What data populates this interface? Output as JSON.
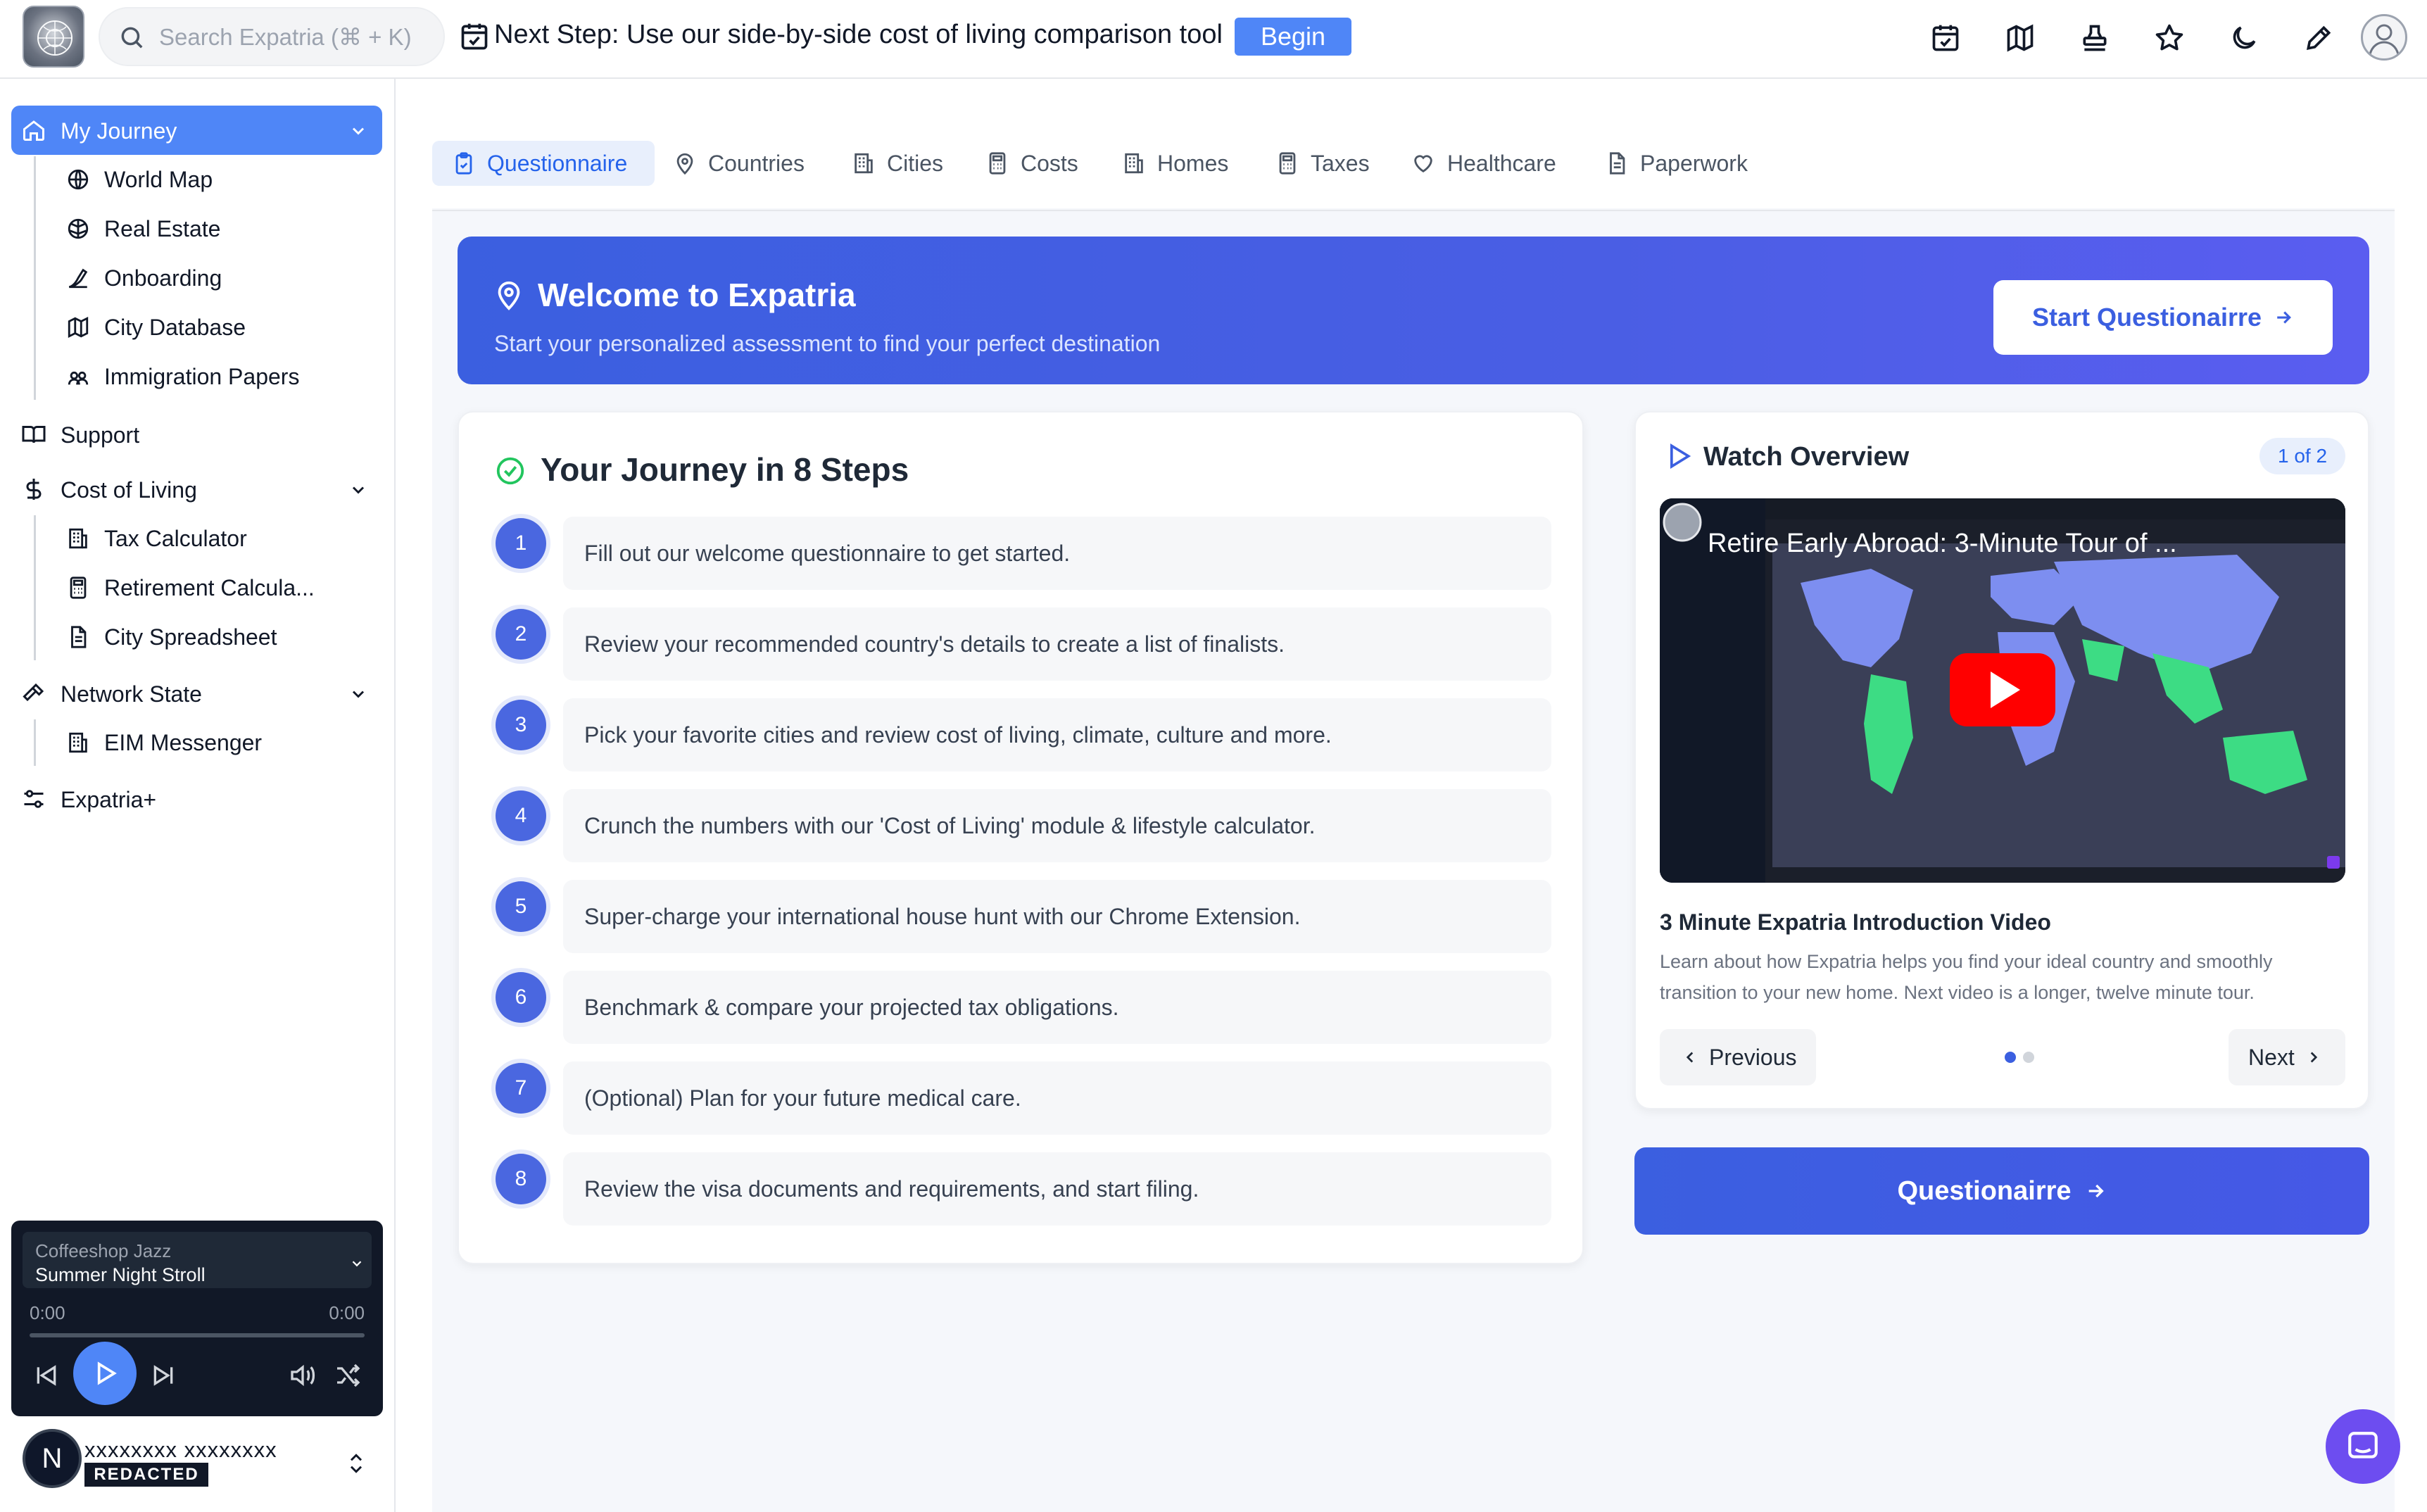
{
  "topbar": {
    "search_placeholder": "Search Expatria (⌘ + K)",
    "next_step_text": "Next Step: Use our side-by-side cost of living comparison tool",
    "begin_label": "Begin",
    "icons": [
      "calendar-check-icon",
      "map-icon",
      "stamp-icon",
      "star-icon",
      "moon-icon",
      "pencil-icon",
      "user-avatar-icon"
    ]
  },
  "sidebar": {
    "my_journey": "My Journey",
    "journey_items": [
      "World Map",
      "Real Estate",
      "Onboarding",
      "City Database",
      "Immigration Papers"
    ],
    "support": "Support",
    "cost_of_living": "Cost of Living",
    "col_items": [
      "Tax Calculator",
      "Retirement Calcula...",
      "City Spreadsheet"
    ],
    "network_state": "Network State",
    "network_items": [
      "EIM Messenger"
    ],
    "expatria_plus": "Expatria+"
  },
  "player": {
    "station": "Coffeeshop Jazz",
    "track": "Summer Night Stroll",
    "time_current": "0:00",
    "time_total": "0:00",
    "progress": 0
  },
  "user": {
    "initial": "N",
    "name": "xxxxxxxx xxxxxxxx",
    "badge": "REDACTED"
  },
  "tabs": [
    {
      "label": "Questionnaire",
      "icon": "clipboard-check-icon",
      "active": true
    },
    {
      "label": "Countries",
      "icon": "map-pin-icon"
    },
    {
      "label": "Cities",
      "icon": "building-icon"
    },
    {
      "label": "Costs",
      "icon": "calculator-icon"
    },
    {
      "label": "Homes",
      "icon": "building-icon"
    },
    {
      "label": "Taxes",
      "icon": "calculator-icon"
    },
    {
      "label": "Healthcare",
      "icon": "heart-icon"
    },
    {
      "label": "Paperwork",
      "icon": "document-icon"
    }
  ],
  "banner": {
    "title": "Welcome to Expatria",
    "subtitle": "Start your personalized assessment to find your perfect destination",
    "button": "Start Questionairre"
  },
  "steps": {
    "title": "Your Journey in 8 Steps",
    "items": [
      {
        "num": "1",
        "text": "Fill out our welcome questionnaire to get started."
      },
      {
        "num": "2",
        "text": "Review your recommended country's details to create a list of finalists."
      },
      {
        "num": "3",
        "text": "Pick your favorite cities and review cost of living, climate, culture and more."
      },
      {
        "num": "4",
        "text": "Crunch the numbers with our 'Cost of Living' module & lifestyle calculator."
      },
      {
        "num": "5",
        "text": "Super-charge your international house hunt with our Chrome Extension."
      },
      {
        "num": "6",
        "text": "Benchmark & compare your projected tax obligations."
      },
      {
        "num": "7",
        "text": "(Optional) Plan for your future medical care."
      },
      {
        "num": "8",
        "text": "Review the visa documents and requirements, and start filing."
      }
    ]
  },
  "video": {
    "section_title": "Watch Overview",
    "counter": "1 of 2",
    "thumb_title": "Retire Early Abroad: 3-Minute Tour of ...",
    "heading": "3 Minute Expatria Introduction Video",
    "description": "Learn about how Expatria helps you find your ideal country and smoothly transition to your new home. Next video is a longer, twelve minute tour.",
    "prev_label": "Previous",
    "next_label": "Next"
  },
  "cta": {
    "label": "Questionairre"
  },
  "colors": {
    "accent": "#4f86f7",
    "banner": "#3b5fe0",
    "step_badge": "#4a67e0",
    "chat": "#6d4df0"
  }
}
